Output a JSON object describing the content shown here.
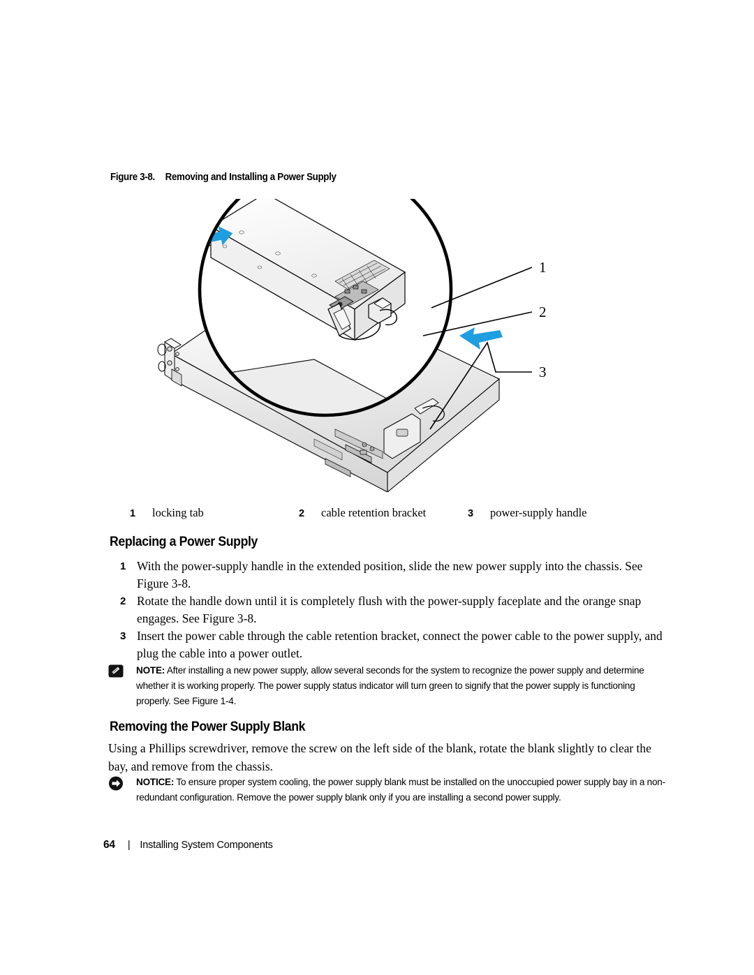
{
  "figure": {
    "caption_number": "Figure 3-8.",
    "caption_title": "Removing and Installing a Power Supply",
    "callouts": [
      {
        "number": "1",
        "label": "locking tab"
      },
      {
        "number": "2",
        "label": "cable retention bracket"
      },
      {
        "number": "3",
        "label": "power-supply handle"
      }
    ],
    "marker_1": "1",
    "marker_2": "2",
    "marker_3": "3",
    "arrow_color": "#1f9ee0",
    "line_color": "#000000",
    "chassis_fill": "#e8e8e8"
  },
  "sections": [
    {
      "heading": "Replacing a Power Supply",
      "steps": [
        {
          "number": "1",
          "text": "With the power-supply handle in the extended position, slide the new power supply into the chassis. See Figure 3-8."
        },
        {
          "number": "2",
          "text": "Rotate the handle down until it is completely flush with the power-supply faceplate and the orange snap engages. See Figure 3-8."
        },
        {
          "number": "3",
          "text": "Insert the power cable through the cable retention bracket, connect the power cable to the power supply, and plug the cable into a power outlet."
        }
      ]
    },
    {
      "heading": "Removing the Power Supply Blank",
      "paragraph": "Using a Phillips screwdriver, remove the screw on the left side of the blank, rotate the blank slightly to clear the bay, and remove from the chassis."
    }
  ],
  "note": {
    "icon": "note-pencil-icon",
    "label": "NOTE:",
    "text": " After installing a new power supply, allow several seconds for the system to recognize the power supply and determine whether it is working properly. The power supply status indicator will turn green to signify that the power supply is functioning properly. See Figure 1-4."
  },
  "notice": {
    "icon": "notice-arrow-icon",
    "label": "NOTICE:",
    "text": " To ensure proper system cooling, the power supply blank must be installed on the unoccupied power supply bay in a non-redundant configuration. Remove the power supply blank only if you are installing a second power supply."
  },
  "footer": {
    "page_number": "64",
    "separator": "|",
    "chapter_title": "Installing System Components"
  }
}
